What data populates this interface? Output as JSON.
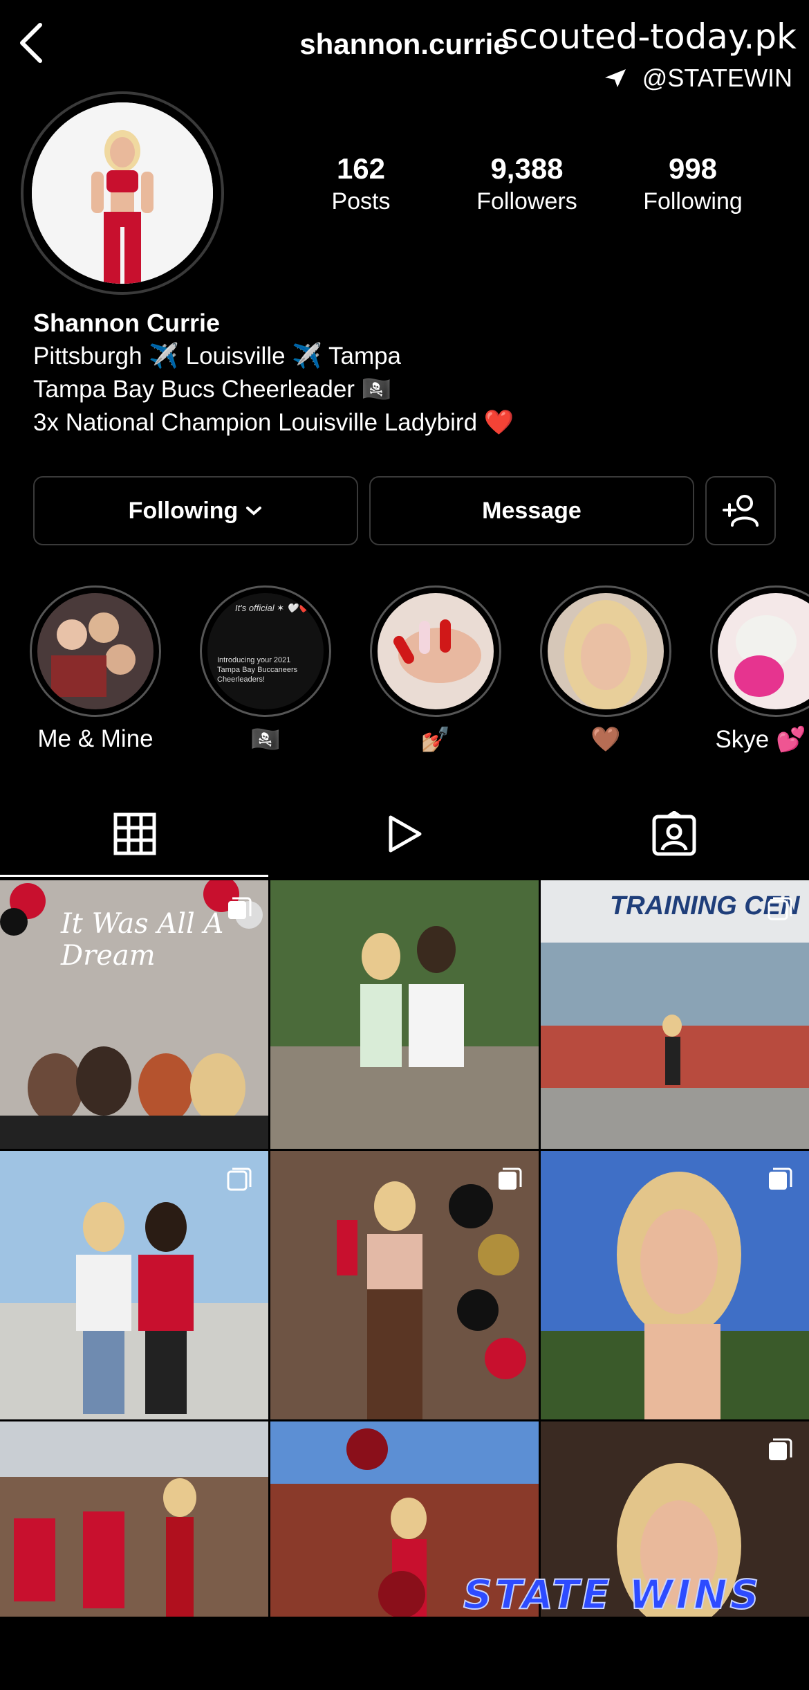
{
  "header": {
    "username": "shannon.currie",
    "watermark": "scouted-today.pk",
    "watermark_handle": "@STATEWIN"
  },
  "profile": {
    "stats": [
      {
        "value": "162",
        "label": "Posts"
      },
      {
        "value": "9,388",
        "label": "Followers"
      },
      {
        "value": "998",
        "label": "Following"
      }
    ],
    "name": "Shannon Currie",
    "bio": [
      "Pittsburgh ✈️ Louisville ✈️ Tampa",
      "Tampa Bay Bucs Cheerleader 🏴‍☠️",
      "3x National Champion Louisville Ladybird ❤️"
    ]
  },
  "actions": {
    "following_label": "Following",
    "message_label": "Message"
  },
  "highlights": [
    {
      "label": "Me & Mine"
    },
    {
      "label": "🏴‍☠️"
    },
    {
      "label": "💅🏼"
    },
    {
      "label": "🤎"
    },
    {
      "label": "Skye 💕"
    }
  ],
  "highlight_texts": {
    "official": "It's official ✶ 🤍❤️",
    "intro": "Introducing your 2021 Tampa Bay Buccaneers Cheerleaders!"
  },
  "tabs": [
    {
      "icon": "grid-icon",
      "active": true
    },
    {
      "icon": "reels-icon",
      "active": false
    },
    {
      "icon": "tagged-icon",
      "active": false
    }
  ],
  "posts": [
    {
      "caption": "It Was All A Dream",
      "multi": true
    },
    {
      "caption": "",
      "multi": false
    },
    {
      "caption": "TRAINING CEN",
      "multi": true
    },
    {
      "caption": "",
      "multi": true
    },
    {
      "caption": "",
      "multi": true
    },
    {
      "caption": "",
      "multi": true
    },
    {
      "caption": "",
      "multi": false
    },
    {
      "caption": "",
      "multi": false
    },
    {
      "caption": "",
      "multi": true
    }
  ],
  "watermark_bottom": "STATE WINS",
  "colors": {
    "background": "#000000",
    "border": "#3a3a3a",
    "watermark_blue": "#2d4bff"
  }
}
